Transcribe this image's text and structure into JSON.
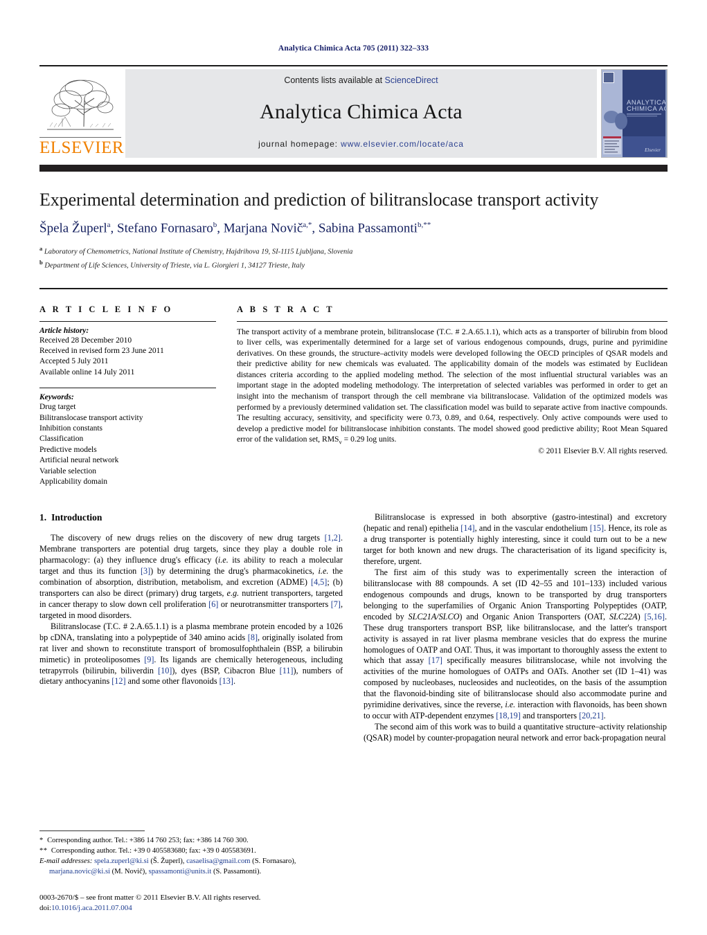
{
  "running_head": "Analytica Chimica Acta 705 (2011) 322–333",
  "masthead": {
    "publisher_wordmark": "ELSEVIER",
    "contents_prefix": "Contents lists available at ",
    "contents_link": "ScienceDirect",
    "journal_title": "Analytica Chimica Acta",
    "homepage_prefix": "journal homepage: ",
    "homepage_url": "www.elsevier.com/locate/aca",
    "cover_title_line1": "ANALYTICA",
    "cover_title_line2": "CHIMICA ACTA",
    "colors": {
      "elsevier_orange": "#f08000",
      "link_blue": "#2a3f8f",
      "band_gray": "#e6e7e9",
      "rule_black": "#231f20"
    }
  },
  "title_block": {
    "title": "Experimental determination and prediction of bilitranslocase transport activity",
    "authors_html": "Špela Župerl<sup>a</sup>, Stefano Fornasaro<sup>b</sup>, Marjana Novič<sup>a,*</sup>, Sabina Passamonti<sup>b,**</sup>",
    "affiliations": [
      {
        "marker": "a",
        "text": "Laboratory of Chemometrics, National Institute of Chemistry, Hajdrihova 19, SI-1115 Ljubljana, Slovenia"
      },
      {
        "marker": "b",
        "text": "Department of Life Sciences, University of Trieste, via L. Giorgieri 1, 34127 Trieste, Italy"
      }
    ]
  },
  "article_info": {
    "label": "A R T I C L E  I N F O",
    "history_heading": "Article history:",
    "history": [
      "Received 28 December 2010",
      "Received in revised form 23 June 2011",
      "Accepted 5 July 2011",
      "Available online 14 July 2011"
    ],
    "keywords_heading": "Keywords:",
    "keywords": [
      "Drug target",
      "Bilitranslocase transport activity",
      "Inhibition constants",
      "Classification",
      "Predictive models",
      "Artificial neural network",
      "Variable selection",
      "Applicability domain"
    ]
  },
  "abstract": {
    "label": "A B S T R A C T",
    "text": "The transport activity of a membrane protein, bilitranslocase (T.C. # 2.A.65.1.1), which acts as a transporter of bilirubin from blood to liver cells, was experimentally determined for a large set of various endogenous compounds, drugs, purine and pyrimidine derivatives. On these grounds, the structure–activity models were developed following the OECD principles of QSAR models and their predictive ability for new chemicals was evaluated. The applicability domain of the models was estimated by Euclidean distances criteria according to the applied modeling method. The selection of the most influential structural variables was an important stage in the adopted modeling methodology. The interpretation of selected variables was performed in order to get an insight into the mechanism of transport through the cell membrane via bilitranslocase. Validation of the optimized models was performed by a previously determined validation set. The classification model was build to separate active from inactive compounds. The resulting accuracy, sensitivity, and specificity were 0.73, 0.89, and 0.64, respectively. Only active compounds were used to develop a predictive model for bilitranslocase inhibition constants. The model showed good predictive ability; Root Mean Squared error of the validation set, RMSv = 0.29 log units.",
    "copyright": "© 2011 Elsevier B.V. All rights reserved."
  },
  "body": {
    "section_number": "1.",
    "section_title": "Introduction",
    "left_paragraphs": [
      "The discovery of new drugs relies on the discovery of new drug targets [1,2]. Membrane transporters are potential drug targets, since they play a double role in pharmacology: (a) they influence drug's efficacy (i.e. its ability to reach a molecular target and thus its function [3]) by determining the drug's pharmacokinetics, i.e. the combination of absorption, distribution, metabolism, and excretion (ADME) [4,5]; (b) transporters can also be direct (primary) drug targets, e.g. nutrient transporters, targeted in cancer therapy to slow down cell proliferation [6] or neurotransmitter transporters [7], targeted in mood disorders.",
      "Bilitranslocase (T.C. # 2.A.65.1.1) is a plasma membrane protein encoded by a 1026 bp cDNA, translating into a polypeptide of 340 amino acids [8], originally isolated from rat liver and shown to reconstitute transport of bromosulfophthalein (BSP, a bilirubin mimetic) in proteoliposomes [9]. Its ligands are chemically heterogeneous, including tetrapyrrols (bilirubin, biliverdin [10]), dyes (BSP, Cibacron Blue [11]), numbers of dietary anthocyanins [12] and some other flavonoids [13]."
    ],
    "right_paragraphs": [
      "Bilitranslocase is expressed in both absorptive (gastro-intestinal) and excretory (hepatic and renal) epithelia [14], and in the vascular endothelium [15]. Hence, its role as a drug transporter is potentially highly interesting, since it could turn out to be a new target for both known and new drugs. The characterisation of its ligand specificity is, therefore, urgent.",
      "The first aim of this study was to experimentally screen the interaction of bilitranslocase with 88 compounds. A set (ID 42–55 and 101–133) included various endogenous compounds and drugs, known to be transported by drug transporters belonging to the superfamilies of Organic Anion Transporting Polypeptides (OATP, encoded by SLC21A/SLCO) and Organic Anion Transporters (OAT, SLC22A) [5,16]. These drug transporters transport BSP, like bilitranslocase, and the latter's transport activity is assayed in rat liver plasma membrane vesicles that do express the murine homologues of OATP and OAT. Thus, it was important to thoroughly assess the extent to which that assay [17] specifically measures bilitranslocase, while not involving the activities of the murine homologues of OATPs and OATs. Another set (ID 1–41) was composed by nucleobases, nucleosides and nucleotides, on the basis of the assumption that the flavonoid-binding site of bilitranslocase should also accommodate purine and pyrimidine derivatives, since the reverse, i.e. interaction with flavonoids, has been shown to occur with ATP-dependent enzymes [18,19] and transporters [20,21].",
      "The second aim of this work was to build a quantitative structure–activity relationship (QSAR) model by counter-propagation neural network and error back-propagation neural"
    ]
  },
  "footnotes": {
    "corresponding_1": "Corresponding author. Tel.: +386 14 760 253; fax: +386 14 760 300.",
    "corresponding_2": "Corresponding author. Tel.: +39 0 405583680; fax: +39 0 405583691.",
    "email_heading": "E-mail addresses:",
    "emails": [
      {
        "address": "spela.zuperl@ki.si",
        "owner": "(Š. Župerl)"
      },
      {
        "address": "casaelisa@gmail.com",
        "owner": "(S. Fornasaro)"
      },
      {
        "address": "marjana.novic@ki.si",
        "owner": "(M. Novič)"
      },
      {
        "address": "spassamonti@units.it",
        "owner": "(S. Passamonti)"
      }
    ],
    "issn_line": "0003-2670/$ – see front matter © 2011 Elsevier B.V. All rights reserved.",
    "doi_prefix": "doi:",
    "doi": "10.1016/j.aca.2011.07.004"
  }
}
